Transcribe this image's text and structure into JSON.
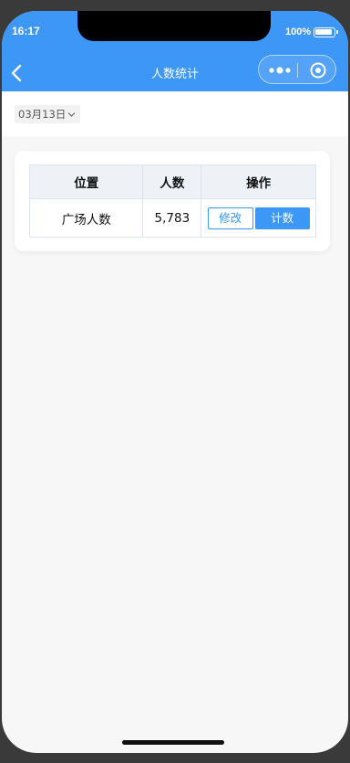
{
  "status_bar": {
    "time": "16:17",
    "battery": "100%"
  },
  "nav": {
    "title": "人数统计"
  },
  "filter": {
    "date": "03月13日"
  },
  "table": {
    "headers": [
      "位置",
      "人数",
      "操作"
    ],
    "rows": [
      {
        "location": "广场人数",
        "count": "5,783",
        "edit_label": "修改",
        "count_label": "计数"
      }
    ]
  },
  "colors": {
    "accent": "#3d97f7",
    "background": "#f7f7f7"
  }
}
